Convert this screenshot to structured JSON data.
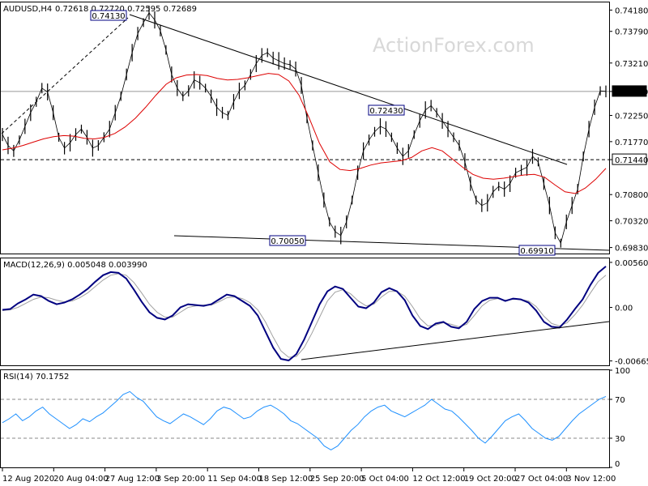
{
  "watermark": "ActionForex.com",
  "main_header": {
    "symbol": "AUDUSD,H4",
    "ohlc": "0.72618 0.72720 0.72595 0.72689"
  },
  "macd_header": "MACD(12,26,9) 0.005048 0.003990",
  "rsi_header": "RSI(14) 70.1752",
  "x_tick_labels": [
    "12 Aug 2020",
    "20 Aug 04:00",
    "27 Aug 12:00",
    "3 Sep 20:00",
    "11 Sep 04:00",
    "18 Sep 12:00",
    "25 Sep 20:00",
    "5 Oct 04:00",
    "12 Oct 12:00",
    "19 Oct 20:00",
    "27 Oct 04:00",
    "3 Nov 12:00"
  ],
  "main_y_ticks": [
    "0.74180",
    "0.73790",
    "0.73210",
    "0.72689",
    "0.72250",
    "0.71770",
    "0.71440",
    "0.70800",
    "0.70320",
    "0.69830"
  ],
  "macd_y_ticks": [
    "0.005605",
    "0.00",
    "-0.006655"
  ],
  "rsi_y_ticks": [
    "100",
    "70",
    "30",
    "0"
  ],
  "annotations": [
    "0.74130",
    "0.72430",
    "0.70050",
    "0.69910"
  ],
  "colors": {
    "price": "#000000",
    "ma": "#dd0000",
    "macd": "#000080",
    "signal": "#a0a0a0",
    "rsi": "#1e90ff",
    "trendline": "#000000"
  },
  "chart_data": [
    {
      "type": "line",
      "title": "AUDUSD,H4",
      "series": [
        {
          "name": "AUDUSD",
          "values": [
            0.719,
            0.717,
            0.716,
            0.718,
            0.7205,
            0.723,
            0.725,
            0.7275,
            0.7268,
            0.723,
            0.7185,
            0.7165,
            0.7175,
            0.719,
            0.72,
            0.7185,
            0.7165,
            0.717,
            0.7185,
            0.72,
            0.723,
            0.726,
            0.73,
            0.734,
            0.7375,
            0.7395,
            0.7413,
            0.74,
            0.738,
            0.7345,
            0.73,
            0.7275,
            0.726,
            0.727,
            0.729,
            0.7285,
            0.7275,
            0.726,
            0.724,
            0.723,
            0.7225,
            0.725,
            0.727,
            0.728,
            0.73,
            0.732,
            0.7335,
            0.734,
            0.733,
            0.7325,
            0.732,
            0.7318,
            0.731,
            0.728,
            0.722,
            0.717,
            0.712,
            0.707,
            0.703,
            0.7012,
            0.7005,
            0.703,
            0.707,
            0.712,
            0.716,
            0.718,
            0.7195,
            0.7205,
            0.72,
            0.7185,
            0.7165,
            0.715,
            0.716,
            0.719,
            0.7215,
            0.7235,
            0.7243,
            0.723,
            0.7215,
            0.72,
            0.7185,
            0.717,
            0.714,
            0.71,
            0.707,
            0.706,
            0.7065,
            0.7085,
            0.7095,
            0.709,
            0.71,
            0.712,
            0.7125,
            0.713,
            0.715,
            0.714,
            0.71,
            0.706,
            0.701,
            0.6991,
            0.703,
            0.706,
            0.709,
            0.715,
            0.72,
            0.724,
            0.727,
            0.7269
          ]
        },
        {
          "name": "MA",
          "values": [
            0.7162,
            0.7165,
            0.717,
            0.7176,
            0.7182,
            0.7186,
            0.7188,
            0.7187,
            0.7183,
            0.7182,
            0.7185,
            0.7192,
            0.7204,
            0.722,
            0.724,
            0.7262,
            0.7282,
            0.7294,
            0.7299,
            0.73,
            0.7298,
            0.7293,
            0.729,
            0.7291,
            0.7294,
            0.7298,
            0.7302,
            0.73,
            0.7288,
            0.7262,
            0.722,
            0.7174,
            0.714,
            0.7126,
            0.7124,
            0.7128,
            0.7134,
            0.7138,
            0.714,
            0.7142,
            0.7148,
            0.716,
            0.7166,
            0.716,
            0.7145,
            0.713,
            0.7117,
            0.711,
            0.7108,
            0.711,
            0.7113,
            0.7116,
            0.7117,
            0.7112,
            0.7098,
            0.7085,
            0.7082,
            0.7092,
            0.7108,
            0.7128
          ]
        }
      ],
      "ylim": [
        0.6972,
        0.7432
      ],
      "levels": [
        0.72689,
        0.7144
      ],
      "trendlines": [
        "resistance from 0.74130 high",
        "support from 0.70050 low"
      ]
    },
    {
      "type": "line",
      "title": "MACD(12,26,9)",
      "series": [
        {
          "name": "MACD",
          "values": [
            -0.0003,
            -0.0002,
            0.0005,
            0.001,
            0.0016,
            0.0014,
            0.0008,
            0.0004,
            0.0006,
            0.001,
            0.0016,
            0.0023,
            0.0032,
            0.004,
            0.0044,
            0.0043,
            0.0036,
            0.0022,
            0.0007,
            -0.0006,
            -0.0013,
            -0.0015,
            -0.001,
            0.0,
            0.0004,
            0.0003,
            0.0002,
            0.0004,
            0.001,
            0.0016,
            0.0014,
            0.0008,
            0.0002,
            -0.001,
            -0.003,
            -0.005,
            -0.0064,
            -0.0066,
            -0.0058,
            -0.004,
            -0.0018,
            0.0004,
            0.002,
            0.0026,
            0.0023,
            0.0012,
            0.0001,
            -0.0001,
            0.0006,
            0.0019,
            0.0024,
            0.002,
            0.0009,
            -0.001,
            -0.0023,
            -0.0027,
            -0.002,
            -0.0018,
            -0.0024,
            -0.0026,
            -0.0018,
            -0.0002,
            0.0008,
            0.0012,
            0.0012,
            0.0008,
            0.0011,
            0.001,
            0.0006,
            -0.0004,
            -0.0018,
            -0.0024,
            -0.0025,
            -0.0015,
            -0.0002,
            0.001,
            0.0028,
            0.0043,
            0.0051
          ]
        },
        {
          "name": "Signal",
          "values": [
            -0.0004,
            -0.0003,
            0.0,
            0.0005,
            0.001,
            0.0013,
            0.0012,
            0.0009,
            0.0007,
            0.0008,
            0.0012,
            0.0018,
            0.0026,
            0.0034,
            0.004,
            0.0042,
            0.004,
            0.0031,
            0.0018,
            0.0004,
            -0.0006,
            -0.0012,
            -0.0012,
            -0.0006,
            0.0,
            0.0002,
            0.0003,
            0.0003,
            0.0007,
            0.0012,
            0.0013,
            0.0011,
            0.0006,
            -0.0003,
            -0.0018,
            -0.0037,
            -0.0054,
            -0.0062,
            -0.0061,
            -0.005,
            -0.0032,
            -0.0012,
            0.0008,
            0.0019,
            0.0022,
            0.0017,
            0.0008,
            0.0002,
            0.0004,
            0.0013,
            0.002,
            0.002,
            0.0014,
            0.0001,
            -0.0014,
            -0.0023,
            -0.0022,
            -0.0019,
            -0.0021,
            -0.0024,
            -0.0021,
            -0.001,
            0.0002,
            0.0009,
            0.0011,
            0.0009,
            0.001,
            0.001,
            0.0008,
            0.0001,
            -0.0011,
            -0.002,
            -0.0023,
            -0.0019,
            -0.0009,
            0.0003,
            0.0018,
            0.0032,
            0.004
          ]
        }
      ],
      "ylim": [
        -0.0072,
        0.0061
      ]
    },
    {
      "type": "line",
      "title": "RSI(14)",
      "series": [
        {
          "name": "RSI",
          "values": [
            46,
            50,
            55,
            48,
            52,
            58,
            62,
            55,
            50,
            45,
            40,
            44,
            50,
            47,
            52,
            56,
            62,
            68,
            75,
            78,
            72,
            68,
            60,
            52,
            48,
            45,
            50,
            55,
            52,
            48,
            44,
            50,
            58,
            62,
            60,
            55,
            50,
            52,
            58,
            62,
            64,
            60,
            55,
            48,
            45,
            40,
            35,
            30,
            22,
            18,
            22,
            30,
            38,
            44,
            52,
            58,
            62,
            64,
            58,
            55,
            52,
            56,
            60,
            64,
            70,
            65,
            60,
            58,
            52,
            45,
            38,
            30,
            25,
            32,
            40,
            48,
            52,
            55,
            48,
            40,
            35,
            30,
            28,
            32,
            40,
            48,
            55,
            60,
            65,
            70,
            73
          ]
        }
      ],
      "ylim": [
        0,
        100
      ],
      "levels": [
        70,
        30
      ]
    }
  ]
}
